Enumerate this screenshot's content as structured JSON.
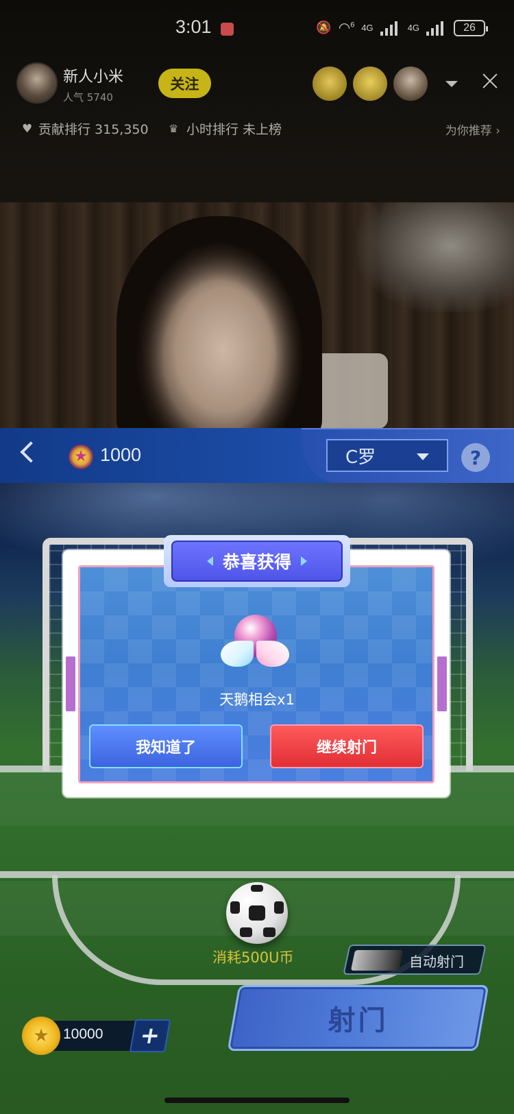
{
  "status_bar": {
    "time": "3:01",
    "net1": "4G",
    "net2": "4G",
    "wifi_badge": "6",
    "battery": "26"
  },
  "host": {
    "name": "新人小米",
    "popularity": "人气 5740",
    "follow_label": "关注"
  },
  "rankings": {
    "contribution": "贡献排行 315,350",
    "hourly": "小时排行 未上榜",
    "recommend": "为你推荐 ›"
  },
  "game": {
    "points": "1000",
    "player_selected": "C罗",
    "help_label": "?",
    "cost_text": "消耗500U币",
    "auto_shoot_label": "自动射门",
    "coins": "10000",
    "add_label": "+",
    "shoot_label": "射门"
  },
  "modal": {
    "title": "恭喜获得",
    "gift_name": "天鹅相会x1",
    "btn_ok": "我知道了",
    "btn_continue": "继续射门"
  },
  "colors": {
    "follow": "#c7b416",
    "header_blue": "#1c4ca6",
    "ok_button": "#3d63df",
    "continue_button": "#e02f36",
    "cost_text": "#d8c23c"
  }
}
